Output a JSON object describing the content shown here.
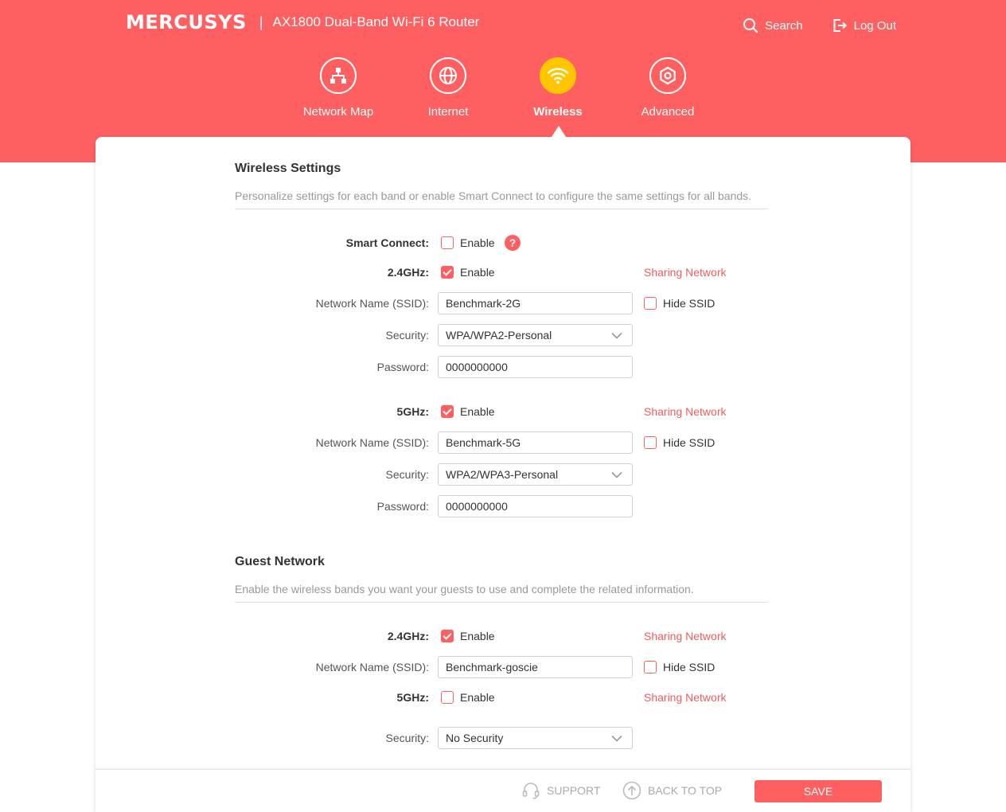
{
  "header": {
    "logo": "MERCUSYS",
    "separator": "|",
    "model": "AX1800 Dual-Band Wi-Fi 6 Router",
    "search_label": "Search",
    "logout_label": "Log Out"
  },
  "nav": {
    "items": [
      {
        "label": "Network Map",
        "icon": "network-map-icon"
      },
      {
        "label": "Internet",
        "icon": "globe-icon"
      },
      {
        "label": "Wireless",
        "icon": "wifi-icon",
        "active": true
      },
      {
        "label": "Advanced",
        "icon": "gear-icon"
      }
    ]
  },
  "colors": {
    "accent": "#fe6061",
    "active_nav": "#ffc600"
  },
  "wireless": {
    "title": "Wireless Settings",
    "description": "Personalize settings for each band or enable Smart Connect to configure the same settings for all bands.",
    "smart_connect": {
      "label": "Smart Connect:",
      "enable_label": "Enable",
      "checked": false
    },
    "band24": {
      "label": "2.4GHz:",
      "enable_label": "Enable",
      "checked": true,
      "sharing": "Sharing Network",
      "ssid_label": "Network Name (SSID):",
      "ssid": "Benchmark-2G",
      "hide_label": "Hide SSID",
      "hide_checked": false,
      "security_label": "Security:",
      "security": "WPA/WPA2-Personal",
      "password_label": "Password:",
      "password": "0000000000"
    },
    "band5": {
      "label": "5GHz:",
      "enable_label": "Enable",
      "checked": true,
      "sharing": "Sharing Network",
      "ssid_label": "Network Name (SSID):",
      "ssid": "Benchmark-5G",
      "hide_label": "Hide SSID",
      "hide_checked": false,
      "security_label": "Security:",
      "security": "WPA2/WPA3-Personal",
      "password_label": "Password:",
      "password": "0000000000"
    }
  },
  "guest": {
    "title": "Guest Network",
    "description": "Enable the wireless bands you want your guests to use and complete the related information.",
    "band24": {
      "label": "2.4GHz:",
      "enable_label": "Enable",
      "checked": true,
      "sharing": "Sharing Network"
    },
    "ssid_label": "Network Name (SSID):",
    "ssid": "Benchmark-goscie",
    "hide_label": "Hide SSID",
    "hide_checked": false,
    "band5": {
      "label": "5GHz:",
      "enable_label": "Enable",
      "checked": false,
      "sharing": "Sharing Network"
    },
    "security_label": "Security:",
    "security": "No Security"
  },
  "footer": {
    "support_label": "SUPPORT",
    "back_to_top_label": "BACK TO TOP",
    "save_label": "SAVE"
  }
}
